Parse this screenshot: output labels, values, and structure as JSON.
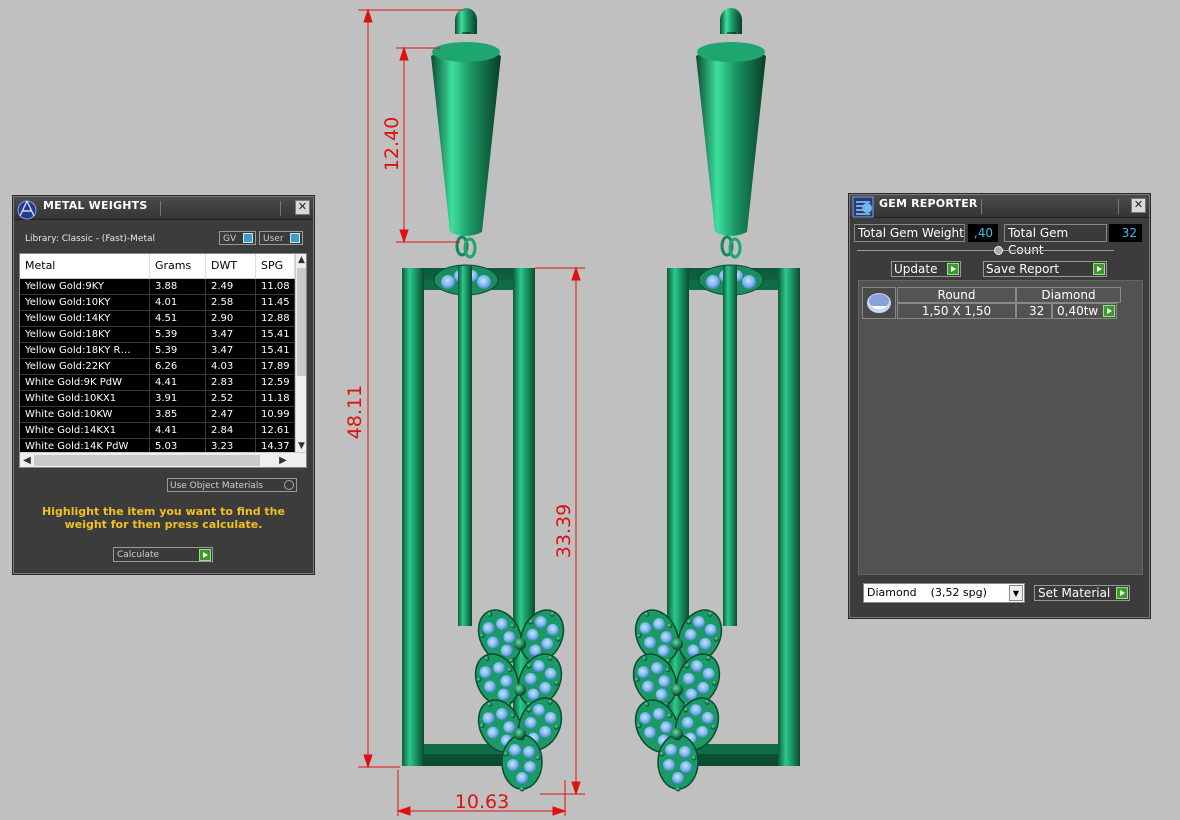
{
  "viewport": {
    "dimensions": {
      "overall_height": "48.11",
      "top_part": "12.40",
      "frame_height": "33.39",
      "frame_width": "10.63"
    }
  },
  "metal_weights": {
    "title": "METAL WEIGHTS",
    "library": "Library: Classic - (Fast)-Metal",
    "toggle_gv": "GV",
    "toggle_user": "User",
    "columns": [
      "Metal",
      "Grams",
      "DWT",
      "SPG"
    ],
    "rows": [
      [
        "Yellow Gold:9KY",
        "3.88",
        "2.49",
        "11.08"
      ],
      [
        "Yellow Gold:10KY",
        "4.01",
        "2.58",
        "11.45"
      ],
      [
        "Yellow Gold:14KY",
        "4.51",
        "2.90",
        "12.88"
      ],
      [
        "Yellow Gold:18KY",
        "5.39",
        "3.47",
        "15.41"
      ],
      [
        "Yellow Gold:18KY R…",
        "5.39",
        "3.47",
        "15.41"
      ],
      [
        "Yellow Gold:22KY",
        "6.26",
        "4.03",
        "17.89"
      ],
      [
        "White Gold:9K PdW",
        "4.41",
        "2.83",
        "12.59"
      ],
      [
        "White Gold:10KX1",
        "3.91",
        "2.52",
        "11.18"
      ],
      [
        "White Gold:10KW",
        "3.85",
        "2.47",
        "10.99"
      ],
      [
        "White Gold:14KX1",
        "4.41",
        "2.84",
        "12.61"
      ],
      [
        "White Gold:14K PdW",
        "5.03",
        "3.23",
        "14.37"
      ]
    ],
    "use_object_materials": "Use Object Materials",
    "hint": "Highlight the item you want to find the weight for then press calculate.",
    "calculate_label": "Calculate"
  },
  "gem_reporter": {
    "title": "GEM REPORTER",
    "total_weight_label": "Total Gem Weight",
    "total_weight_value": ",40",
    "total_count_label": "Total Gem Count",
    "total_count_value": "32",
    "update_label": "Update",
    "save_report_label": "Save Report",
    "columns": [
      "Round",
      "Diamond"
    ],
    "row": {
      "size": "1,50 X 1,50",
      "count": "32",
      "weight": "0,40tw"
    },
    "material_select": "Diamond    (3,52 spg)",
    "set_material_label": "Set Material"
  },
  "colors": {
    "background": "#c0c0c0",
    "metal": "#1a8f5e",
    "gem": "#7eb8f0",
    "dimension": "#e01010",
    "panel": "#3c3c3c",
    "hint": "#f0c020"
  }
}
